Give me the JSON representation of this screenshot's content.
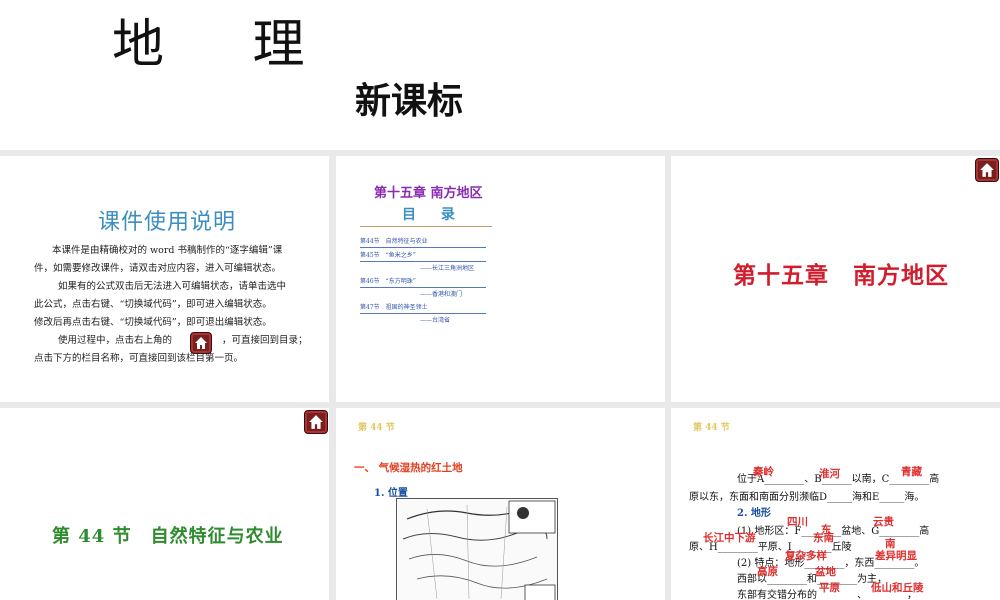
{
  "header": {
    "subject": "地 理",
    "edition": "新课标"
  },
  "usage": {
    "title": "课件使用说明",
    "paragraphs": [
      "本课件是由精确校对的 word 书稿制作的“逐字编辑”课",
      "件，如需要修改课件，请双击对应内容，进入可编辑状态。",
      "如果有的公式双击后无法进入可编辑状态，请单击选中",
      "此公式，点击右键、“切换域代码”，即可进入编辑状态。",
      "修改后再点击右键、“切换域代码”，即可退出编辑状态。",
      "使用过程中，点击右上角的",
      "，可直接回到目录；",
      "点击下方的栏目名称，可直接回到该栏目第一页。"
    ]
  },
  "toc": {
    "chapter": "第十五章  南方地区",
    "title": "目 录",
    "items": [
      "第44节　自然特征与农业",
      "第45节　“鱼米之乡”",
      "——长江三角洲地区",
      "第46节　“东方明珠”",
      "——香港和澳门",
      "第47节　祖国的神圣领土",
      "——台湾省"
    ]
  },
  "chapter_slide": {
    "title": "第十五章　南方地区"
  },
  "section_slide": {
    "title": "第 44 节　自然特征与农业"
  },
  "content_slide": {
    "tag": "第 44 节",
    "heading": "一、 气候湿热的红土地",
    "sub": "1. 位置"
  },
  "answer_slide": {
    "tag": "第 44 节",
    "lines": [
      "位于A________、B______以南，C________高",
      "原以东，东面和南面分别濒临D_____海和E_____海。",
      "2. 地形",
      "(1) 地形区：F________盆地、G________高",
      "原、H________平原、I________丘陵",
      "(2) 特点：地形________，东西________。",
      "西部以________和________为主，",
      "东部有交错分布的________、________，"
    ],
    "answers": [
      "秦岭",
      "淮河",
      "青藏",
      "四川",
      "云贵",
      "长江中下游",
      "东",
      "南",
      "东南",
      "复杂多样",
      "差异明显",
      "高原",
      "盆地",
      "平原",
      "低山和丘陵"
    ]
  },
  "icons": {
    "home": "home-icon"
  },
  "colors": {
    "accent_red": "#d01e2e",
    "accent_blue": "#3a8fbf",
    "green": "#2e8b2e",
    "purple": "#8a2bb0",
    "home_bg": "#7a1f1f"
  }
}
